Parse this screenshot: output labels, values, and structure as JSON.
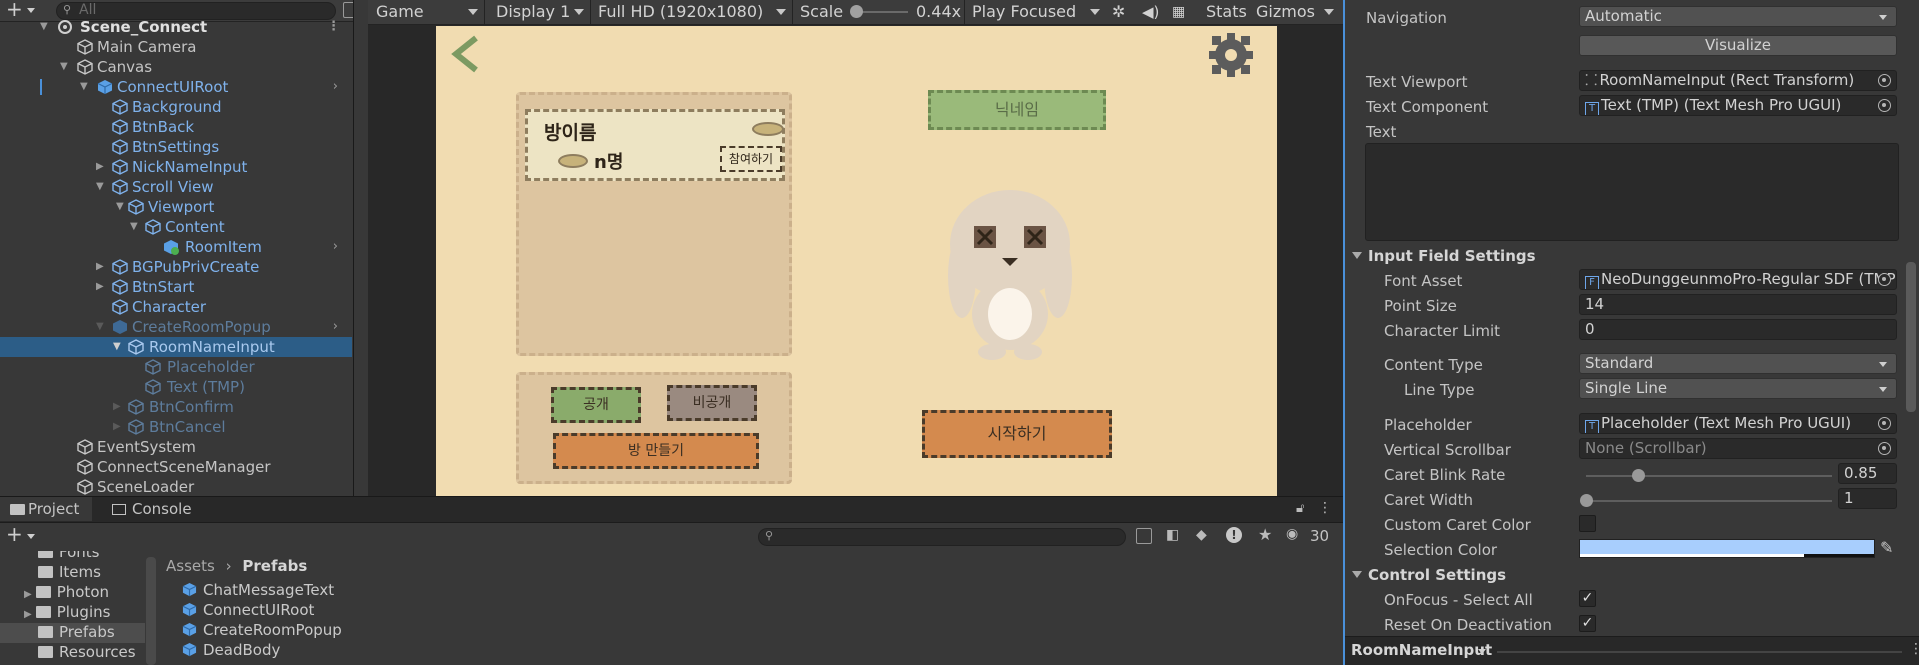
{
  "hierarchy": {
    "search_placeholder": "All",
    "items": [
      {
        "label": "Scene_Connect"
      },
      {
        "label": "Main Camera"
      },
      {
        "label": "Canvas"
      },
      {
        "label": "ConnectUIRoot"
      },
      {
        "label": "Background"
      },
      {
        "label": "BtnBack"
      },
      {
        "label": "BtnSettings"
      },
      {
        "label": "NickNameInput"
      },
      {
        "label": "Scroll View"
      },
      {
        "label": "Viewport"
      },
      {
        "label": "Content"
      },
      {
        "label": "RoomItem"
      },
      {
        "label": "BGPubPrivCreate"
      },
      {
        "label": "BtnStart"
      },
      {
        "label": "Character"
      },
      {
        "label": "CreateRoomPopup"
      },
      {
        "label": "RoomNameInput"
      },
      {
        "label": "Placeholder"
      },
      {
        "label": "Text (TMP)"
      },
      {
        "label": "BtnConfirm"
      },
      {
        "label": "BtnCancel"
      },
      {
        "label": "EventSystem"
      },
      {
        "label": "ConnectSceneManager"
      },
      {
        "label": "SceneLoader"
      }
    ]
  },
  "game_toolbar": {
    "view": "Game",
    "display": "Display 1",
    "resolution": "Full HD (1920x1080)",
    "scale_label": "Scale",
    "scale_value": "0.44x",
    "play_mode": "Play Focused",
    "stats": "Stats",
    "gizmos": "Gizmos"
  },
  "game_ui": {
    "room_name": "방이름",
    "room_count": "n명",
    "join_button": "참여하기",
    "nickname": "닉네임",
    "public_button": "공개",
    "private_button": "비공개",
    "create_room_button": "방 만들기",
    "start_button": "시작하기"
  },
  "inspector": {
    "navigation_label": "Navigation",
    "navigation_value": "Automatic",
    "visualize_button": "Visualize",
    "text_viewport_label": "Text Viewport",
    "text_viewport_value": "RoomNameInput (Rect Transform)",
    "text_component_label": "Text Component",
    "text_component_value": "Text (TMP) (Text Mesh Pro UGUI)",
    "text_label": "Text",
    "input_field_settings": "Input Field Settings",
    "font_asset_label": "Font Asset",
    "font_asset_value": "NeoDunggeunmoPro-Regular SDF (TMP",
    "point_size_label": "Point Size",
    "point_size_value": "14",
    "char_limit_label": "Character Limit",
    "char_limit_value": "0",
    "content_type_label": "Content Type",
    "content_type_value": "Standard",
    "line_type_label": "Line Type",
    "line_type_value": "Single Line",
    "placeholder_label": "Placeholder",
    "placeholder_value": "Placeholder (Text Mesh Pro UGUI)",
    "vscrollbar_label": "Vertical Scrollbar",
    "vscrollbar_value": "None (Scrollbar)",
    "caret_blink_label": "Caret Blink Rate",
    "caret_blink_value": "0.85",
    "caret_blink_fraction": 0.2125,
    "caret_width_label": "Caret Width",
    "caret_width_value": "1",
    "caret_width_fraction": 0.0,
    "custom_caret_label": "Custom Caret Color",
    "selection_color_label": "Selection Color",
    "selection_color": "#a8cefd",
    "control_settings": "Control Settings",
    "onfocus_label": "OnFocus - Select All",
    "reset_label": "Reset On Deactivation",
    "footer_object": "RoomNameInput"
  },
  "project": {
    "tab_project": "Project",
    "tab_console": "Console",
    "count": "30",
    "folders": [
      "Fonts",
      "Items",
      "Photon",
      "Plugins",
      "Prefabs",
      "Resources"
    ],
    "breadcrumb_root": "Assets",
    "breadcrumb_current": "Prefabs",
    "assets": [
      "ChatMessageText",
      "ConnectUIRoot",
      "CreateRoomPopup",
      "DeadBody"
    ]
  },
  "colors": {
    "selection_blue": "#2c5d87",
    "prefab_blue": "#7fb2ec",
    "game_bg": "#f1dcb1",
    "green_button": "#8aab6b",
    "orange_button": "#d48a4e",
    "gray_button": "#9a8a80"
  }
}
